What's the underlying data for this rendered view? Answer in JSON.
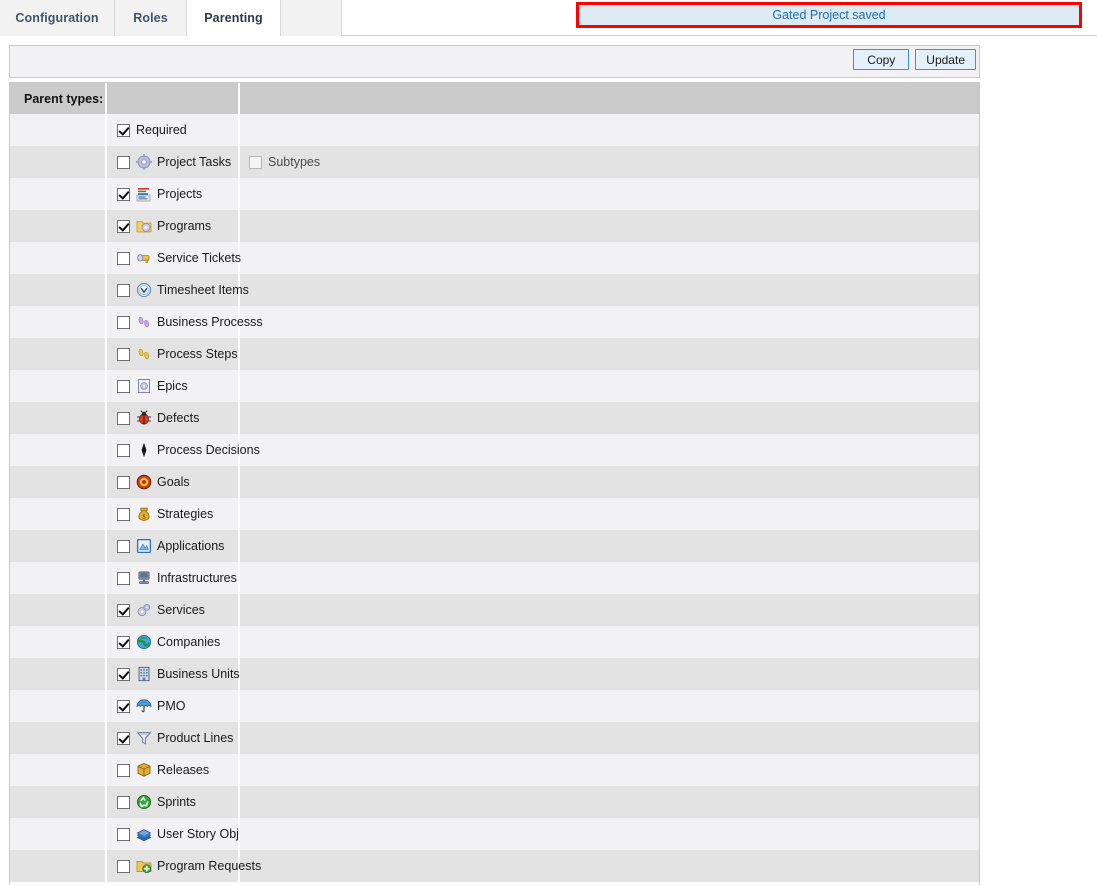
{
  "tabs": [
    {
      "label": "Configuration",
      "active": false
    },
    {
      "label": "Roles",
      "active": false
    },
    {
      "label": "Parenting",
      "active": true
    }
  ],
  "banner": {
    "message": "Gated Project saved",
    "text_color": "#1f6fb0",
    "background_color": "#dceaf4",
    "border_color": "#ff0000"
  },
  "toolbar": {
    "copy_label": "Copy",
    "update_label": "Update",
    "button_border_color": "#3a93d4",
    "button_background_color": "#e4f0fa"
  },
  "table": {
    "header_label": "Parent types:",
    "header_background": "#cbcbcb",
    "row_shade_color": "#e3e3e3",
    "row_plain_color": "#f2f2f4",
    "rows": [
      {
        "label": "Required",
        "checked": true,
        "icon": "none",
        "shade": false,
        "extra": null
      },
      {
        "label": "Project Tasks",
        "checked": false,
        "icon": "gear-icon",
        "shade": true,
        "extra": {
          "label": "Subtypes",
          "checked": false,
          "disabled": true
        }
      },
      {
        "label": "Projects",
        "checked": true,
        "icon": "project-list-icon",
        "shade": false,
        "extra": null
      },
      {
        "label": "Programs",
        "checked": true,
        "icon": "folder-gear-icon",
        "shade": true,
        "extra": null
      },
      {
        "label": "Service Tickets",
        "checked": false,
        "icon": "key-icon",
        "shade": false,
        "extra": null
      },
      {
        "label": "Timesheet Items",
        "checked": false,
        "icon": "clock-icon",
        "shade": true,
        "extra": null
      },
      {
        "label": "Business Processs",
        "checked": false,
        "icon": "purple-footprints-icon",
        "shade": false,
        "extra": null
      },
      {
        "label": "Process Steps",
        "checked": false,
        "icon": "yellow-footprints-icon",
        "shade": true,
        "extra": null
      },
      {
        "label": "Epics",
        "checked": false,
        "icon": "epic-document-icon",
        "shade": false,
        "extra": null
      },
      {
        "label": "Defects",
        "checked": false,
        "icon": "bug-icon",
        "shade": true,
        "extra": null
      },
      {
        "label": "Process Decisions",
        "checked": false,
        "icon": "diamond-icon",
        "shade": false,
        "extra": null
      },
      {
        "label": "Goals",
        "checked": false,
        "icon": "target-icon",
        "shade": true,
        "extra": null
      },
      {
        "label": "Strategies",
        "checked": false,
        "icon": "money-bag-icon",
        "shade": false,
        "extra": null
      },
      {
        "label": "Applications",
        "checked": false,
        "icon": "application-window-icon",
        "shade": true,
        "extra": null
      },
      {
        "label": "Infrastructures",
        "checked": false,
        "icon": "server-icon",
        "shade": false,
        "extra": null
      },
      {
        "label": "Services",
        "checked": true,
        "icon": "gears-icon",
        "shade": true,
        "extra": null
      },
      {
        "label": "Companies",
        "checked": true,
        "icon": "globe-icon",
        "shade": false,
        "extra": null
      },
      {
        "label": "Business Units",
        "checked": true,
        "icon": "building-icon",
        "shade": true,
        "extra": null
      },
      {
        "label": "PMO",
        "checked": true,
        "icon": "umbrella-icon",
        "shade": false,
        "extra": null
      },
      {
        "label": "Product Lines",
        "checked": true,
        "icon": "funnel-icon",
        "shade": true,
        "extra": null
      },
      {
        "label": "Releases",
        "checked": false,
        "icon": "package-icon",
        "shade": false,
        "extra": null
      },
      {
        "label": "Sprints",
        "checked": false,
        "icon": "recycle-icon",
        "shade": true,
        "extra": null
      },
      {
        "label": "User Story Obj",
        "checked": false,
        "icon": "book-icon",
        "shade": false,
        "extra": null
      },
      {
        "label": "Program Requests",
        "checked": false,
        "icon": "folder-add-icon",
        "shade": true,
        "extra": null
      }
    ]
  }
}
